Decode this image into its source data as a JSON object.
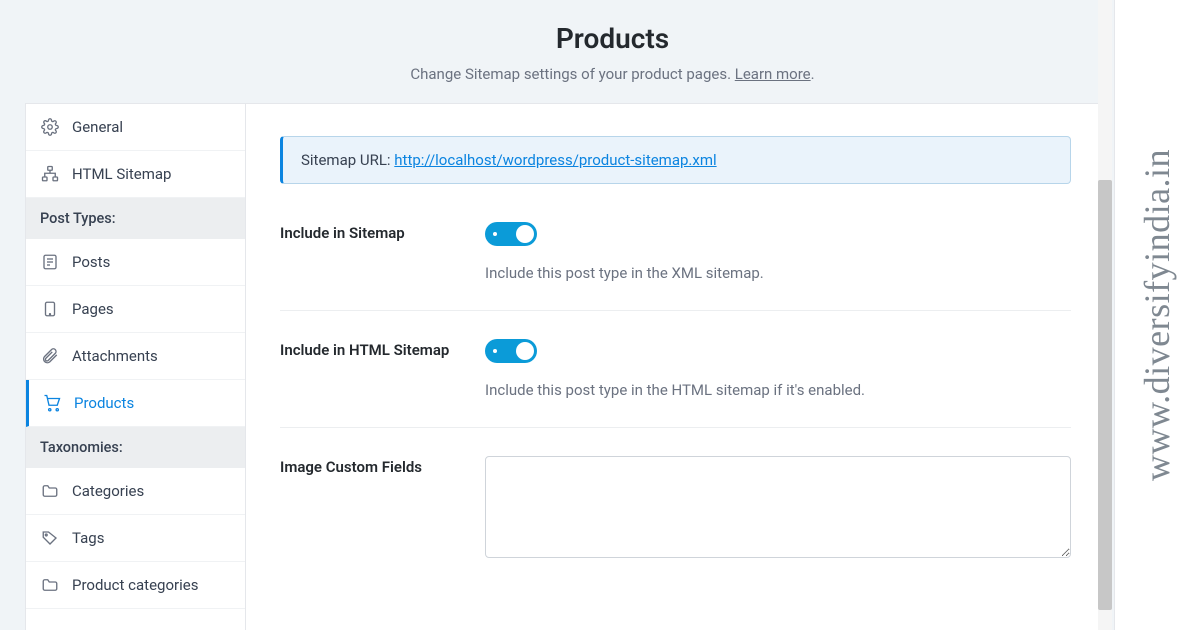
{
  "header": {
    "title": "Products",
    "subtitle_prefix": "Change Sitemap settings of your product pages. ",
    "learn_more": "Learn more",
    "subtitle_suffix": "."
  },
  "sidebar": {
    "general": "General",
    "html_sitemap": "HTML Sitemap",
    "post_types_heading": "Post Types:",
    "posts": "Posts",
    "pages": "Pages",
    "attachments": "Attachments",
    "products": "Products",
    "taxonomies_heading": "Taxonomies:",
    "categories": "Categories",
    "tags": "Tags",
    "product_categories": "Product categories"
  },
  "notice": {
    "label": "Sitemap URL: ",
    "url": "http://localhost/wordpress/product-sitemap.xml"
  },
  "settings": {
    "include_sitemap": {
      "label": "Include in Sitemap",
      "desc": "Include this post type in the XML sitemap.",
      "value": true
    },
    "include_html": {
      "label": "Include in HTML Sitemap",
      "desc": "Include this post type in the HTML sitemap if it's enabled.",
      "value": true
    },
    "image_fields": {
      "label": "Image Custom Fields",
      "value": ""
    }
  },
  "watermark": "www.diversifyindia.in"
}
